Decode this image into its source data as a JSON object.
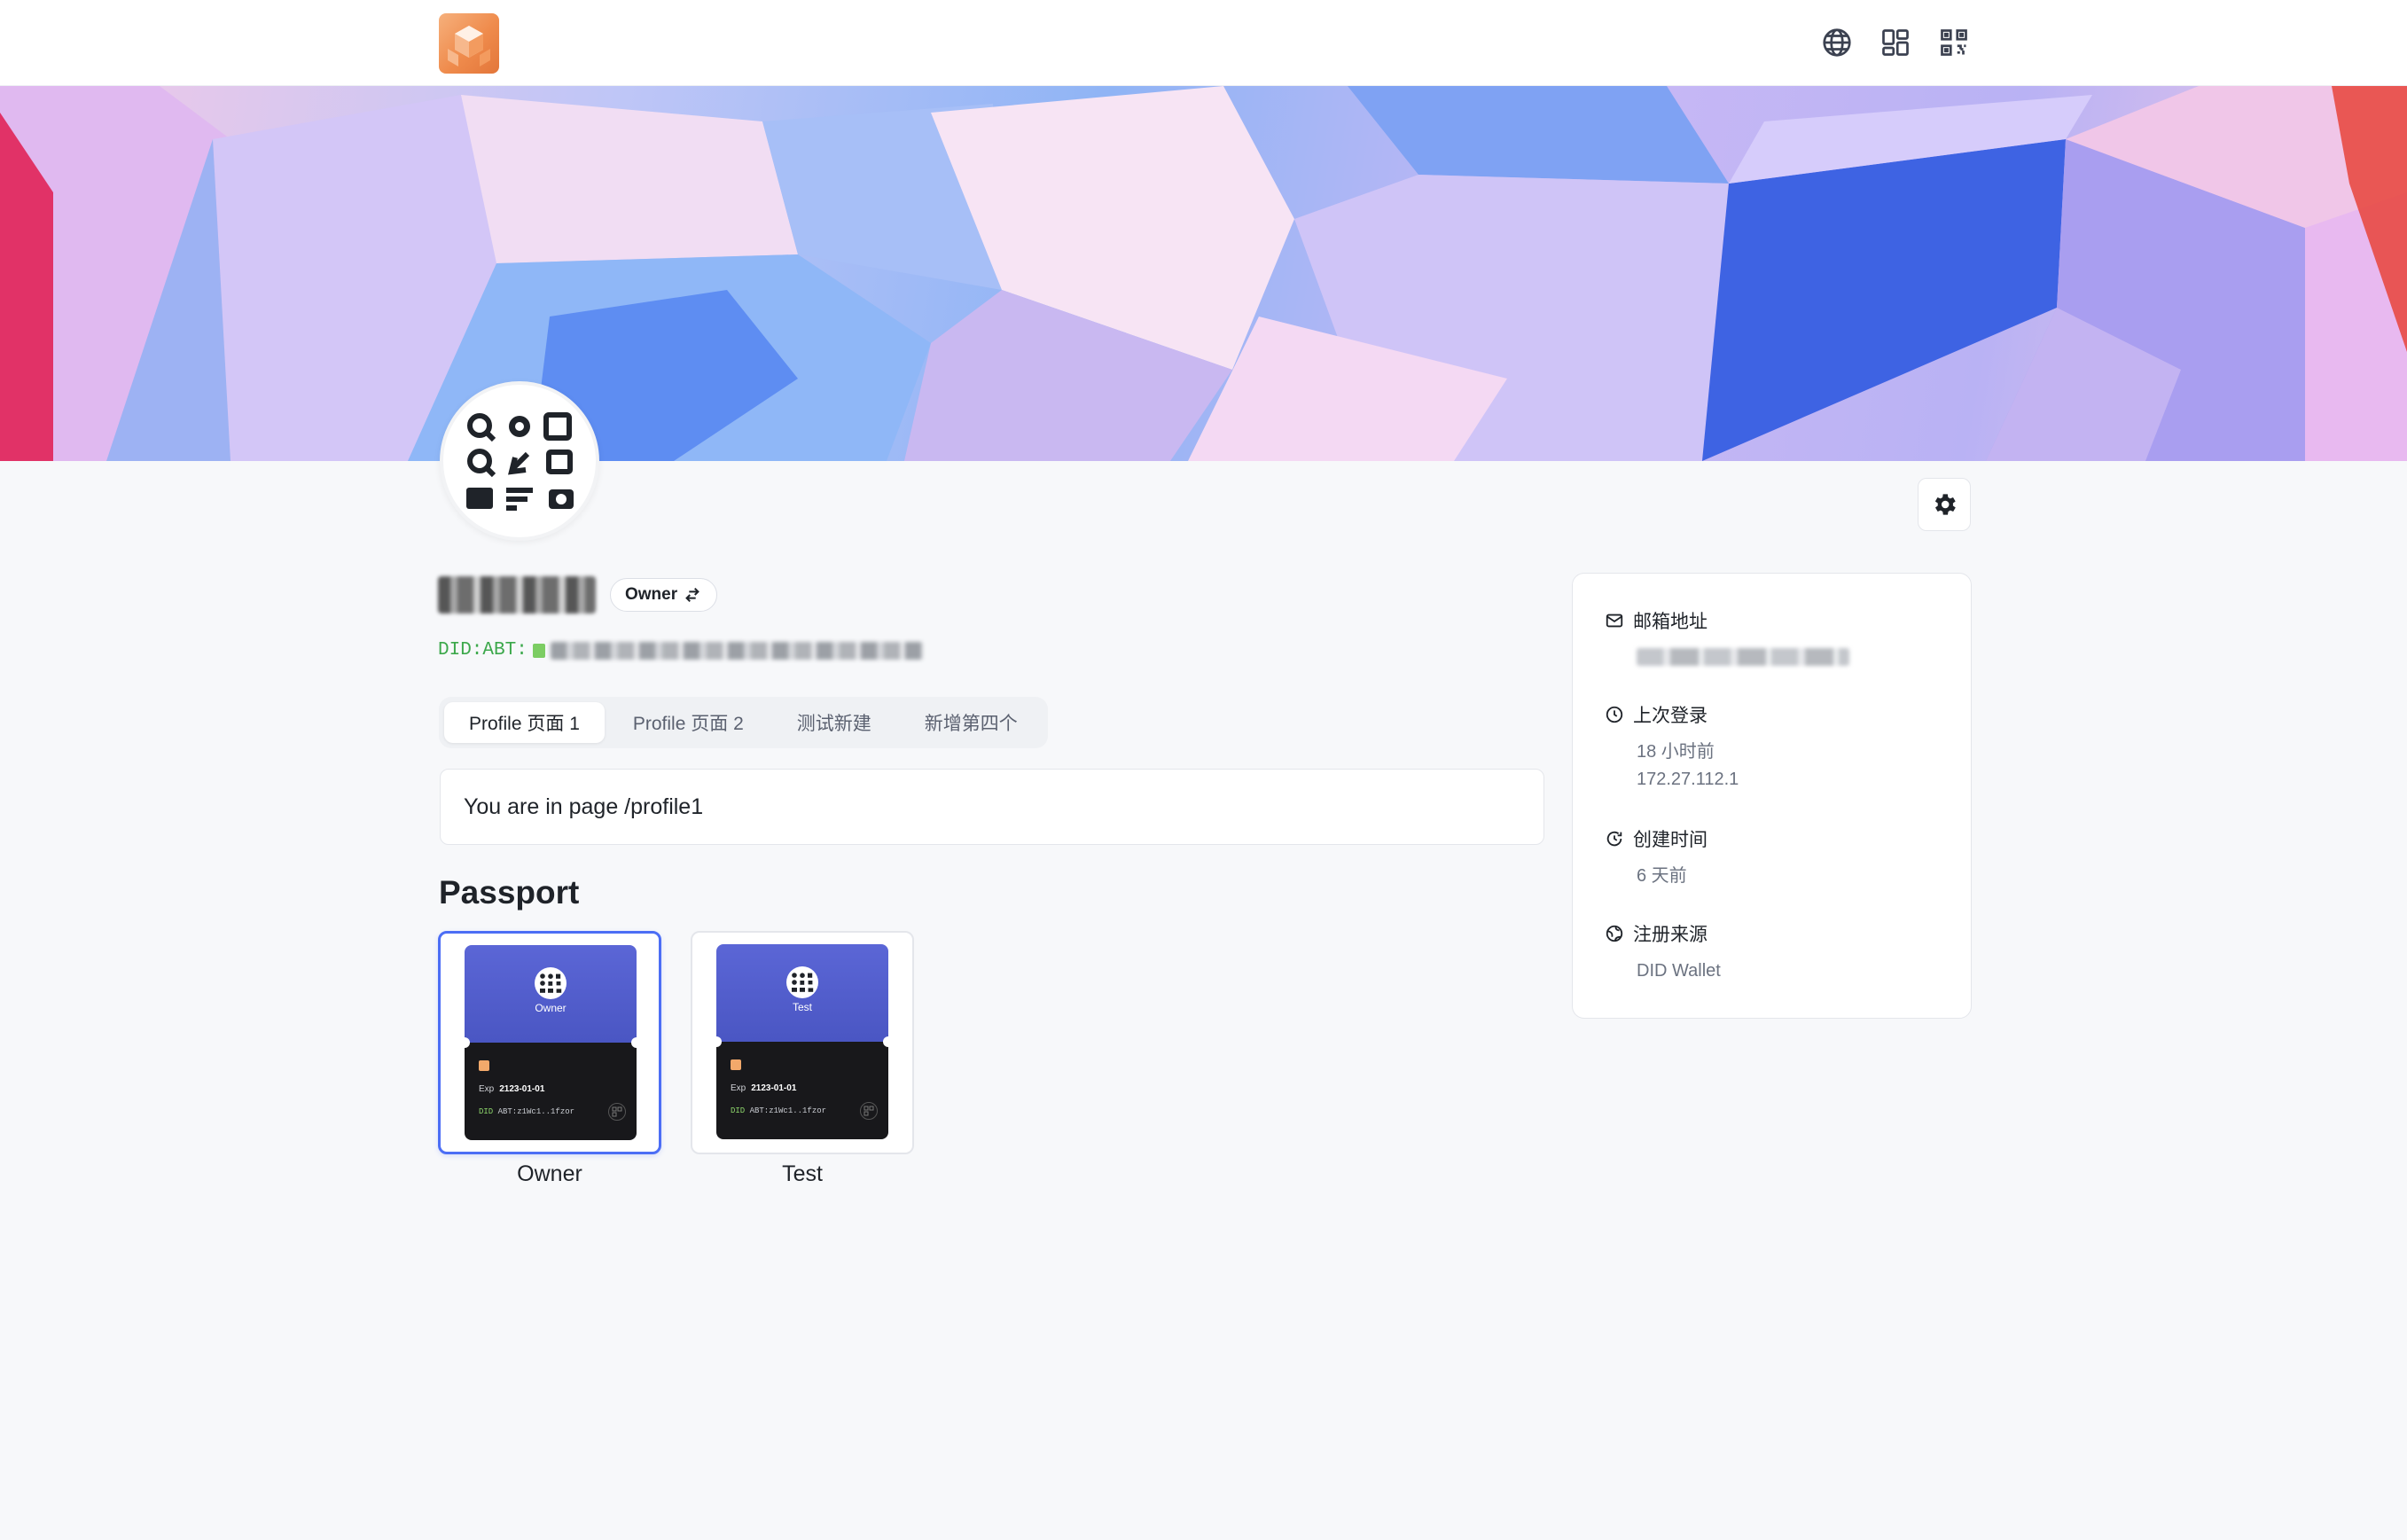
{
  "header": {
    "logo_name": "app-logo",
    "icons": [
      "globe-icon",
      "dashboard-icon",
      "qrcode-icon"
    ]
  },
  "profile": {
    "owner_badge": "Owner",
    "did_prefix": "DID:ABT:"
  },
  "tabs": [
    {
      "label": "Profile 页面 1",
      "active": true
    },
    {
      "label": "Profile 页面 2",
      "active": false
    },
    {
      "label": "测试新建",
      "active": false
    },
    {
      "label": "新增第四个",
      "active": false
    }
  ],
  "content": {
    "text": "You are in page /profile1"
  },
  "passport": {
    "title": "Passport",
    "cards": [
      {
        "role": "Owner",
        "exp_label": "Exp",
        "exp_date": "2123-01-01",
        "did_prefix": "DID",
        "did_mid": "ABT:",
        "did_short": "z1Wc1..1fzor",
        "label": "Owner",
        "selected": true
      },
      {
        "role": "Test",
        "exp_label": "Exp",
        "exp_date": "2123-01-01",
        "did_prefix": "DID",
        "did_mid": "ABT:",
        "did_short": "z1Wc1..1fzor",
        "label": "Test",
        "selected": false
      }
    ]
  },
  "info": {
    "email_label": "邮箱地址",
    "last_login_label": "上次登录",
    "last_login_time": "18 小时前",
    "last_login_ip": "172.27.112.1",
    "created_label": "创建时间",
    "created_value": "6 天前",
    "source_label": "注册来源",
    "source_value": "DID Wallet"
  },
  "colors": {
    "accent": "#4c6ef5",
    "did_green": "#3ca84b",
    "passport_top": "#5b66d6",
    "passport_bottom": "#18181b"
  }
}
